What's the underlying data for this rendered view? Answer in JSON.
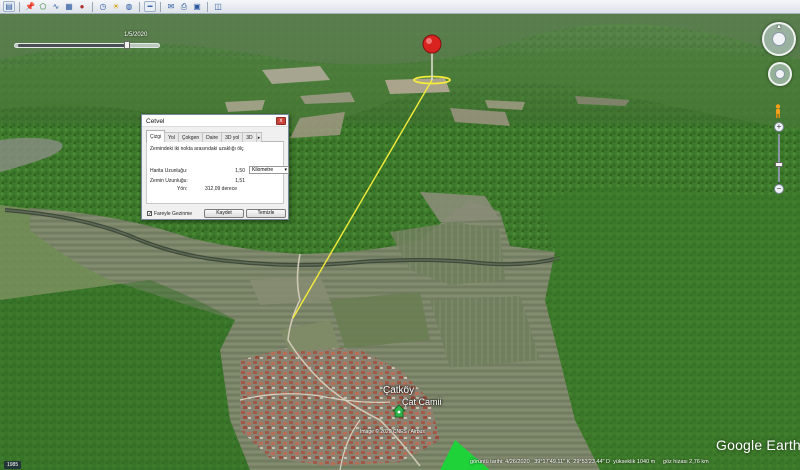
{
  "toolbar": {
    "icons": [
      "sidebar-icon",
      "placemark-icon",
      "polygon-icon",
      "path-icon",
      "overlay-icon",
      "tour-icon",
      "planet-icon",
      "sunlight-icon",
      "history-icon",
      "ruler-icon",
      "email-icon",
      "print-icon",
      "save-image-icon",
      "maps-icon"
    ]
  },
  "time_slider": {
    "label": "1/5/2020",
    "position": 0.78
  },
  "ruler_dialog": {
    "title": "Cetvel",
    "close_label": "x",
    "tabs": [
      "Çizgi",
      "Yol",
      "Çokgen",
      "Daire",
      "3D yol",
      "3D"
    ],
    "active_tab": "Çizgi",
    "tab_scroll_label": "▸",
    "description": "Zemindeki iki nokta arasındaki uzaklığı ölç",
    "map_length_label": "Harita Uzunluğu:",
    "map_length_value": "1,50",
    "unit_select": "Kilometre",
    "ground_length_label": "Zemin Uzunluğu:",
    "ground_length_value": "1,51",
    "heading_label": "Yön:",
    "heading_value": "312,09 derece",
    "mouse_nav_label": "Fareyle Gezinme",
    "mouse_nav_checked": true,
    "save_label": "Kaydet",
    "clear_label": "Temizle"
  },
  "map": {
    "village_label": "Çatköy",
    "mosque_label": "Çat Camii",
    "image_credit": "Image © 2020 CNES / Airbus",
    "logo": "Google Earth"
  },
  "status": {
    "scale_badge": "1985",
    "imagery_date": "görüntü tarihi: 4/26/2020",
    "latitude": "39°17'49.11\" K",
    "longitude": "29°53'23.44\" D",
    "elevation": "yükseklik 1040 m",
    "eye_alt": "göz hizası 2,76 km"
  },
  "colors": {
    "ruler_line": "#f4ec3a",
    "placemark": "#d9231f",
    "forest": "#3f7a2c",
    "fields": "#7d8a6e"
  }
}
